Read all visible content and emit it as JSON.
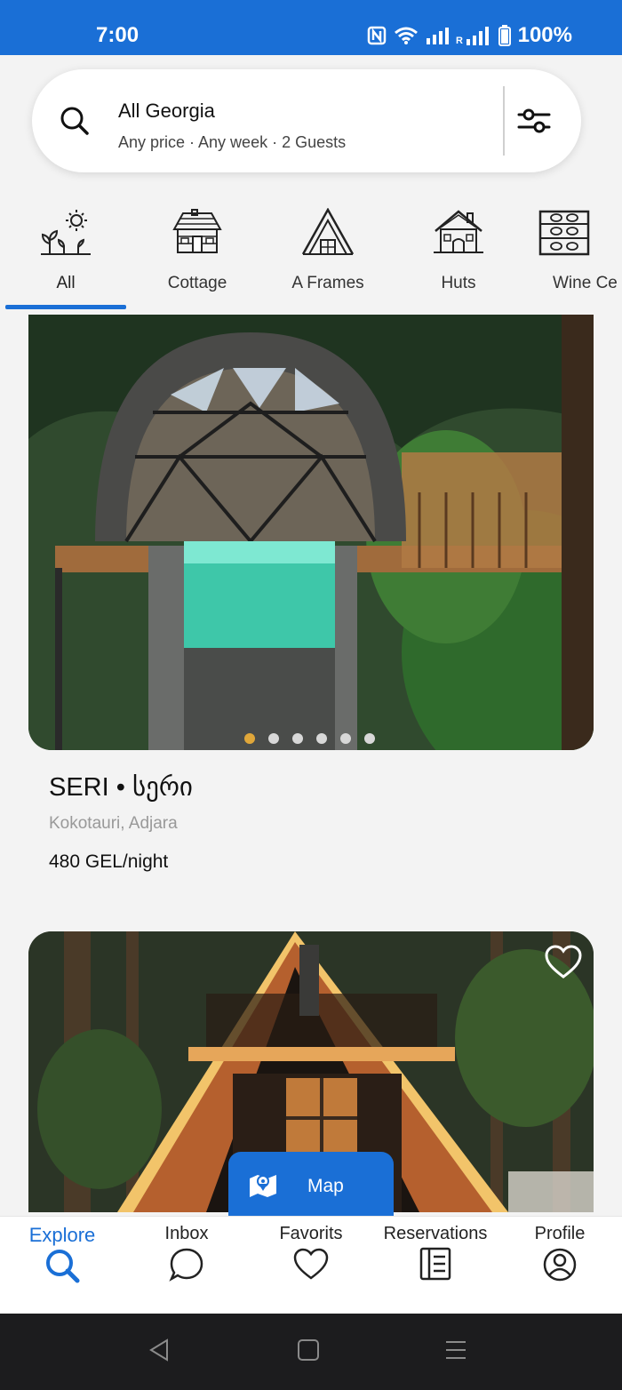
{
  "status_bar": {
    "time": "7:00",
    "battery": "100%",
    "icons": [
      "nfc-icon",
      "wifi-icon",
      "signal-icon",
      "roaming-signal-icon",
      "battery-icon"
    ],
    "background_color": "#1a6fd6"
  },
  "search": {
    "title": "All Georgia",
    "subtitle": "Any price · Any week · 2 Guests",
    "icons": [
      "search-icon",
      "filter-sliders-icon"
    ]
  },
  "categories": [
    {
      "label": "All",
      "icon": "sun-plants-icon",
      "active": true
    },
    {
      "label": "Cottage",
      "icon": "cottage-icon",
      "active": false
    },
    {
      "label": "A Frames",
      "icon": "a-frame-icon",
      "active": false
    },
    {
      "label": "Huts",
      "icon": "hut-icon",
      "active": false
    },
    {
      "label": "Wine Ce",
      "icon": "wine-cellar-icon",
      "active": false
    }
  ],
  "listings": [
    {
      "image": "dome-treehouse-with-glass-pool-photo",
      "title": "SERI • სერი",
      "location": "Kokotauri, Adjara",
      "price": "480 GEL/night",
      "photo_count": 6,
      "current_photo": 1
    },
    {
      "image": "a-frame-cabin-in-forest-photo",
      "favorite": false
    }
  ],
  "map_button": {
    "label": "Map",
    "icon": "map-icon"
  },
  "bottom_nav": [
    {
      "label": "Explore",
      "icon": "search-icon",
      "active": true
    },
    {
      "label": "Inbox",
      "icon": "chat-bubble-icon",
      "active": false
    },
    {
      "label": "Favorits",
      "icon": "heart-icon",
      "active": false
    },
    {
      "label": "Reservations",
      "icon": "document-icon",
      "active": false
    },
    {
      "label": "Profile",
      "icon": "profile-icon",
      "active": false
    }
  ],
  "colors": {
    "accent": "#1a6fd6",
    "active_dot": "#e0a73a",
    "background": "#f3f3f3"
  }
}
